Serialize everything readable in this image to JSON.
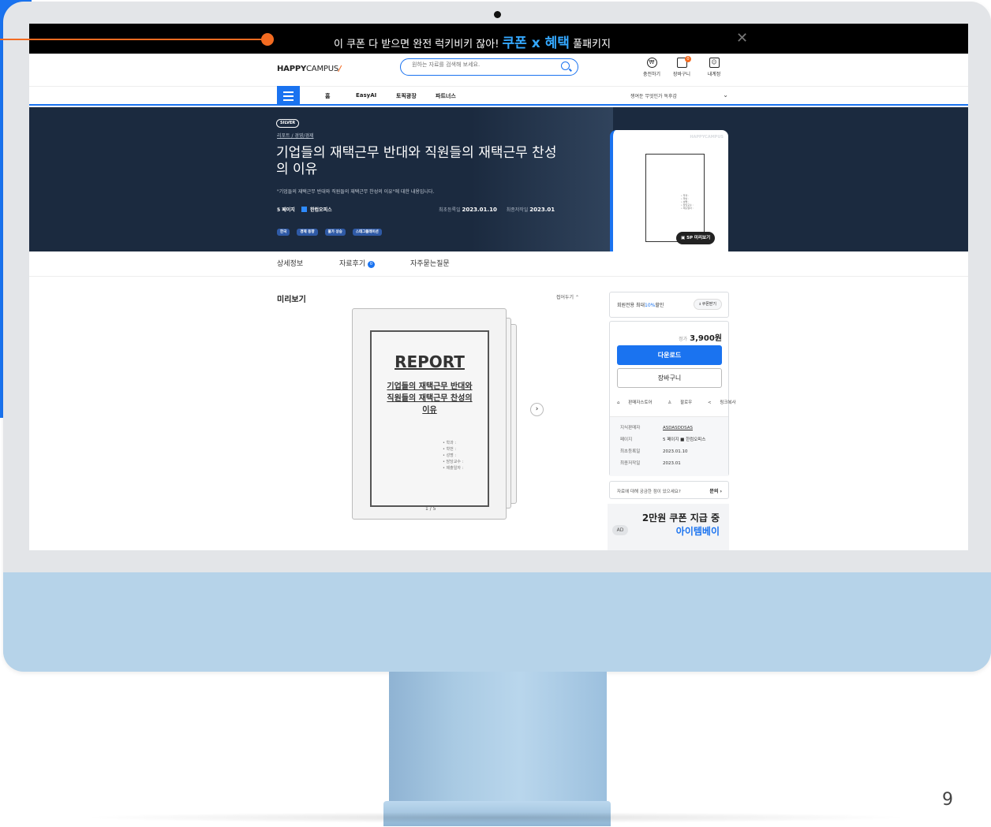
{
  "banner": {
    "text_before": "이 쿠폰 다 받으면 완전 럭키비키 잖아!",
    "highlight": "쿠폰 x 혜택",
    "text_after": "풀패키지",
    "close_label": "✕"
  },
  "header": {
    "logo_bold": "HAPPY",
    "logo_light": "CAMPUS",
    "logo_mark": "/",
    "search_placeholder": "원하는 자료를 검색해 보세요.",
    "utilities": [
      {
        "label": "충전하기",
        "icon": "charge-icon"
      },
      {
        "label": "장바구니",
        "icon": "cart-icon",
        "badge": "0"
      },
      {
        "label": "내계정",
        "icon": "account-icon"
      }
    ]
  },
  "nav": {
    "items": [
      "홈",
      "EasyAI",
      "토픽광장",
      "파트너스"
    ],
    "select_text": "쟁여둔 무엇인가 독후감"
  },
  "hero": {
    "grade": "SILVER",
    "breadcrumb": "리포트 / 경영/경제",
    "title": "기업들의 재택근무 반대와 직원들의 재택근무 찬성의 이유",
    "description": "\"기업들의 재택근무 반대와 직원들의 재택근무 찬성의 이유\"에 대한 내용입니다.",
    "pages": "5 페이지",
    "publisher": "한컴오피스",
    "first_reg_label": "최초등록일",
    "first_reg_value": "2023.01.10",
    "last_write_label": "최종저작일",
    "last_write_value": "2023.01",
    "tags": [
      "한국",
      "경제 동향",
      "물가 상승",
      "스태그플레이션"
    ],
    "thumb_brand": "HAPPYCAMPUS",
    "thumb_report": "REPORT",
    "thumb_title": "기업들의 재택근무 반대와 직원들의 재택근무 찬성의 이유",
    "preview_label": "5P 미리보기"
  },
  "tabs": [
    {
      "label": "상세정보"
    },
    {
      "label": "자료후기",
      "count": "0"
    },
    {
      "label": "자주묻는질문"
    }
  ],
  "preview": {
    "title": "미리보기",
    "collapse_label": "접어두기 ⌃",
    "report": "REPORT",
    "doc_title_1": "기업들의 재택근무 반대와",
    "doc_title_2": "직원들의 재택근무 찬성의",
    "doc_title_3": "이유",
    "bullets": "• 학과 :\n• 학번 :\n• 성명 :\n• 담당교수 :\n• 제출일자 :",
    "page_indicator": "1 / 5",
    "next_label": "›"
  },
  "sidebar": {
    "coupon_text_1": "회원전용 최대",
    "coupon_percent": "10%",
    "coupon_text_2": "할인",
    "coupon_button": "쿠폰받기",
    "price_label": "정가",
    "price_value": "3,900원",
    "download": "다운로드",
    "cart": "장바구니",
    "actions": [
      "판매자스토어",
      "팔로우",
      "링크복사"
    ],
    "info": [
      {
        "key": "지식판매자",
        "value": "ASDASDDSAS"
      },
      {
        "key": "페이지",
        "value": "5 페이지  ■ 한컴오피스"
      },
      {
        "key": "최초등록일",
        "value": "2023.01.10"
      },
      {
        "key": "최종저작일",
        "value": "2023.01"
      }
    ],
    "ask_text": "자료에 대해 궁금한 점이 있으세요?",
    "ask_button": "문의 ›",
    "ad_tag": "AD",
    "ad_line1": "2만원 쿠폰 지급 중",
    "ad_line2": "아이템베이"
  },
  "page_number": "9"
}
